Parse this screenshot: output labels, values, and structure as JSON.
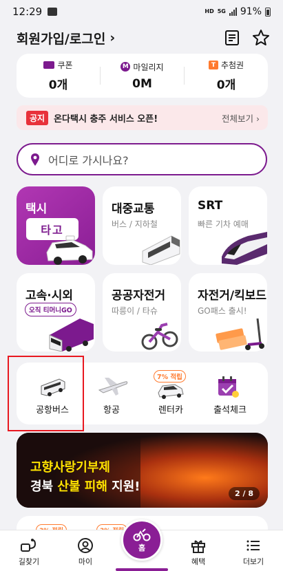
{
  "status_bar": {
    "time": "12:29",
    "battery": "91%",
    "network_tag_top": "HD",
    "network_tag_5g": "5G"
  },
  "header": {
    "login_label": "회원가입/로그인",
    "chevron": "›"
  },
  "summary": {
    "coupon": {
      "label": "쿠폰",
      "value": "0개"
    },
    "mileage": {
      "label": "마일리지",
      "value": "0M",
      "icon_text": "M"
    },
    "lottery": {
      "label": "추첨권",
      "value": "0개",
      "icon_text": "T"
    }
  },
  "notice": {
    "badge": "공지",
    "text": "온다택시 충주 서비스 오픈!",
    "view_all": "전체보기 ›"
  },
  "search": {
    "placeholder": "어디로 가시나요?"
  },
  "tiles": {
    "taxi": {
      "title": "택시",
      "logo": "타고"
    },
    "public": {
      "title": "대중교통",
      "sub": "버스 / 지하철"
    },
    "srt": {
      "title": "SRT",
      "sub": "빠른 기차 예매"
    },
    "intercity": {
      "title": "고속·시외",
      "pill": "오직 티머니GO"
    },
    "bike": {
      "title": "공공자전거",
      "sub": "따릉이 / 타슈"
    },
    "kickboard": {
      "title": "자전거/킥보드",
      "sub": "GO패스 출시!"
    }
  },
  "quick": {
    "airport_bus": {
      "label": "공항버스"
    },
    "air": {
      "label": "항공"
    },
    "rentcar": {
      "label": "렌터카",
      "badge": "7% 적립"
    },
    "attendance": {
      "label": "출석체크"
    }
  },
  "banner": {
    "line1": "고향사랑기부제",
    "line2_a": "경북 ",
    "line2_b": "산불 피해",
    "line2_c": " 지원!",
    "page": "2 / 8"
  },
  "peek": {
    "badge1": "3% 적립",
    "badge2": "3% 적립"
  },
  "nav": {
    "route": {
      "label": "길찾기"
    },
    "my": {
      "label": "마이"
    },
    "home": {
      "label": "홈"
    },
    "benefit": {
      "label": "혜택"
    },
    "more": {
      "label": "더보기"
    }
  },
  "colors": {
    "brand_purple": "#7c1a8e",
    "notice_red": "#e8313a",
    "accent_orange": "#ff7a2e",
    "highlight_red": "#e8171f"
  }
}
